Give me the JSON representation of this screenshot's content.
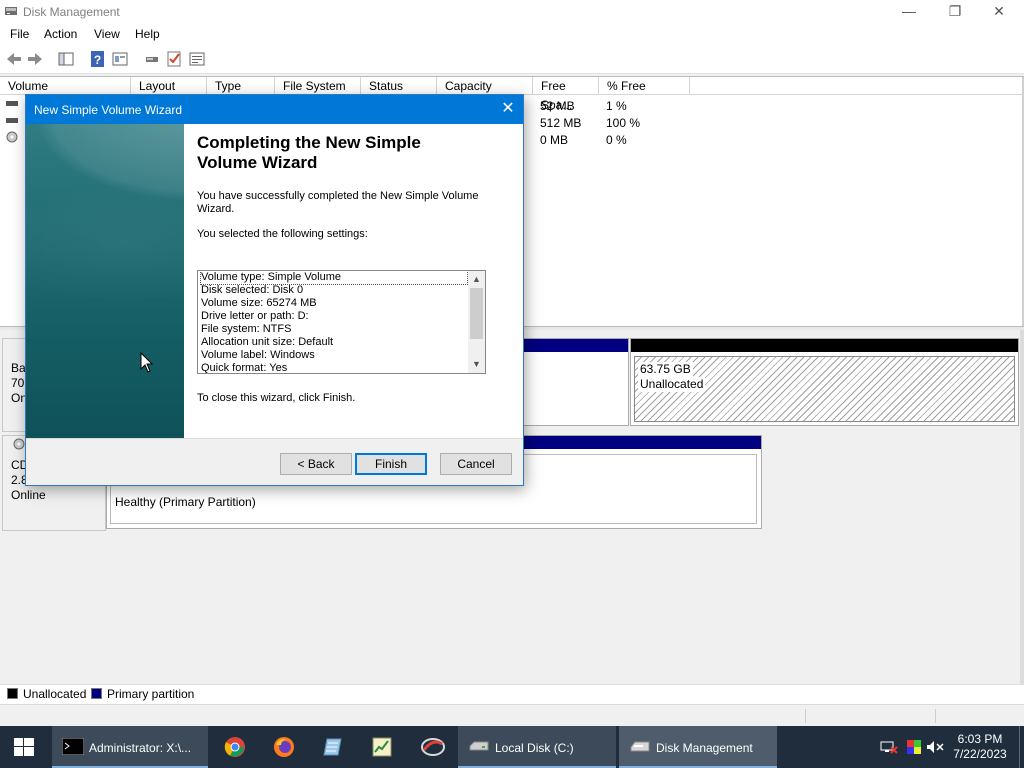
{
  "window": {
    "title": "Disk Management",
    "minimize": "—",
    "restore": "❐",
    "close": "✕"
  },
  "menu": [
    "File",
    "Action",
    "View",
    "Help"
  ],
  "volume_list": {
    "columns": [
      "Volume",
      "Layout",
      "Type",
      "File System",
      "Status",
      "Capacity",
      "Free Spa...",
      "% Free"
    ],
    "rows": [
      {
        "free": "52 MB",
        "pct_free": "1 %"
      },
      {
        "free": "512 MB",
        "pct_free": "100 %"
      },
      {
        "free": "0 MB",
        "pct_free": "0 %"
      }
    ]
  },
  "disks": {
    "disk0_label_lines": [
      "Ba",
      "70.",
      "On"
    ],
    "unallocated_size": "63.75 GB",
    "unallocated_text": "Unallocated",
    "cd_label_lines": [
      "CD",
      "2.8",
      "Online"
    ],
    "cd_partition_status": "Healthy (Primary Partition)"
  },
  "legend": {
    "unallocated": "Unallocated",
    "primary": "Primary partition",
    "colors": {
      "unallocated": "#000000",
      "primary": "#000080"
    }
  },
  "wizard": {
    "title": "New Simple Volume Wizard",
    "close": "✕",
    "heading_line1": "Completing the New Simple",
    "heading_line2": "Volume Wizard",
    "success_line1": "You have successfully completed the New Simple Volume",
    "success_line2": "Wizard.",
    "selected_label": "You selected the following settings:",
    "settings": [
      "Volume type: Simple Volume",
      "Disk selected: Disk 0",
      "Volume size: 65274 MB",
      "Drive letter or path: D:",
      "File system: NTFS",
      "Allocation unit size: Default",
      "Volume label: Windows",
      "Quick format: Yes"
    ],
    "close_hint": "To close this wizard, click Finish.",
    "back_button": "< Back",
    "finish_button": "Finish",
    "cancel_button": "Cancel"
  },
  "taskbar": {
    "cmd_task": "Administrator: X:\\...",
    "explorer_task": "Local Disk (C:)",
    "diskmgmt_task": "Disk Management",
    "time": "6:03 PM",
    "date": "7/22/2023"
  }
}
